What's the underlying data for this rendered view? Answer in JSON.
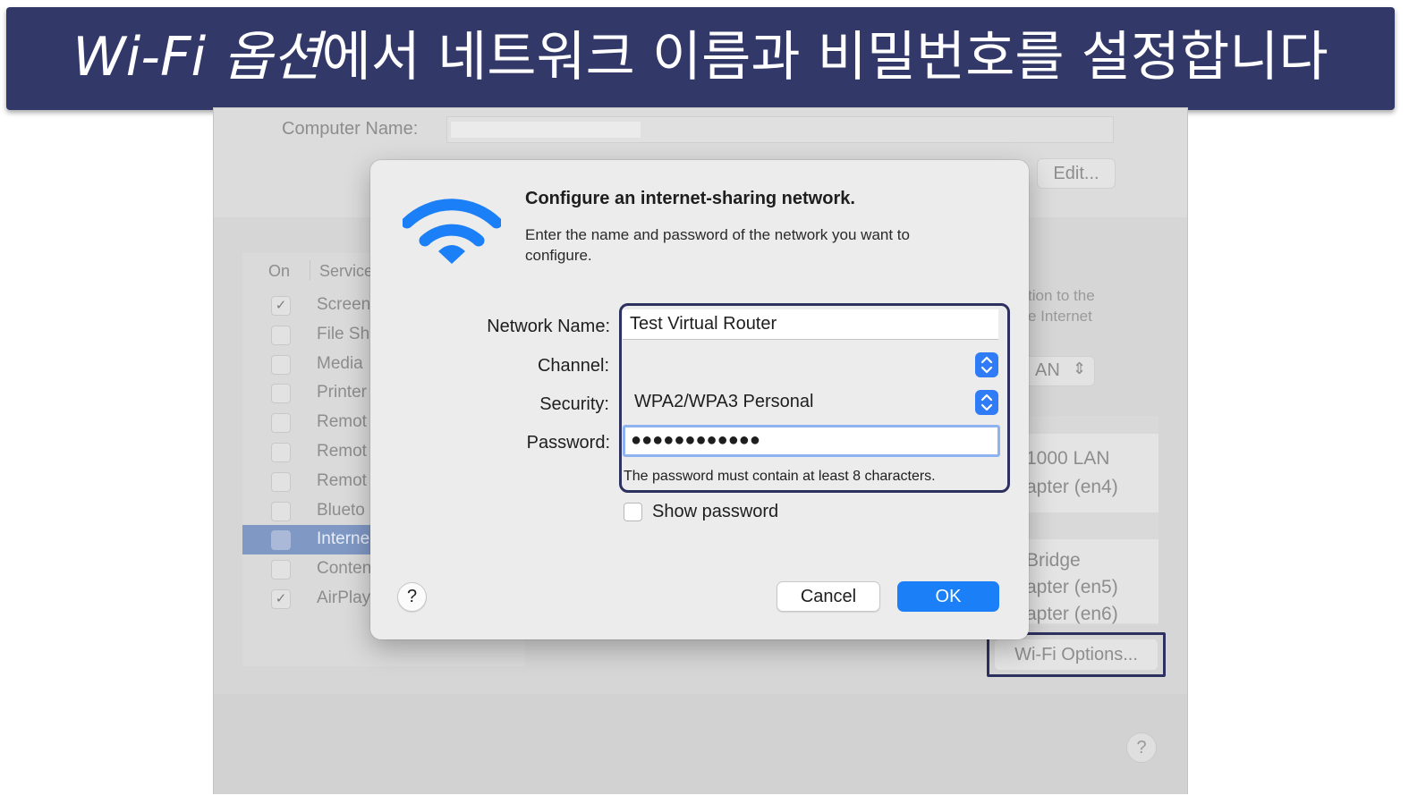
{
  "banner": {
    "title_em": "Wi-Fi 옵션",
    "title_rest": "에서 네트워크 이름과 비밀번호를 설정합니다"
  },
  "background": {
    "computer_name_label": "Computer Name:",
    "edit_button": "Edit...",
    "services_header": {
      "on": "On",
      "service": "Service"
    },
    "services": [
      {
        "label": "Screen",
        "checked": true,
        "selected": false
      },
      {
        "label": "File Sh",
        "checked": false,
        "selected": false
      },
      {
        "label": "Media",
        "checked": false,
        "selected": false
      },
      {
        "label": "Printer",
        "checked": false,
        "selected": false
      },
      {
        "label": "Remot",
        "checked": false,
        "selected": false
      },
      {
        "label": "Remot",
        "checked": false,
        "selected": false
      },
      {
        "label": "Remot",
        "checked": false,
        "selected": false
      },
      {
        "label": "Blueto",
        "checked": false,
        "selected": false
      },
      {
        "label": "Interne",
        "checked": false,
        "selected": true
      },
      {
        "label": "Conten",
        "checked": false,
        "selected": false
      },
      {
        "label": "AirPlay",
        "checked": true,
        "selected": false
      }
    ],
    "share_desc_line1": "tion to the",
    "share_desc_line2": "e Internet",
    "popup_value": "AN",
    "ports": {
      "group1": [
        "1000 LAN",
        "apter (en4)"
      ],
      "group2": [
        "Bridge",
        "apter (en5)",
        "apter (en6)"
      ]
    },
    "wifi_options_button": "Wi-Fi Options...",
    "help": "?"
  },
  "dialog": {
    "title": "Configure an internet-sharing network.",
    "description": "Enter the name and password of the network you want to configure.",
    "labels": {
      "network_name": "Network Name:",
      "channel": "Channel:",
      "security": "Security:",
      "password": "Password:"
    },
    "network_name_value": "Test Virtual Router",
    "channel_value": "",
    "security_value": "WPA2/WPA3 Personal",
    "password_value": "●●●●●●●●●●●●",
    "password_hint": "The password must contain at least 8 characters.",
    "show_password_label": "Show password",
    "show_password_checked": false,
    "help": "?",
    "cancel": "Cancel",
    "ok": "OK"
  },
  "colors": {
    "banner_bg": "#323868",
    "highlight_outline": "#2e3160",
    "accent_blue": "#1b7ff7",
    "wifi_icon": "#1b7ff7"
  },
  "icons": [
    "wifi-icon",
    "stepper-icon",
    "checkmark-icon",
    "chevron-updown-icon",
    "help-icon"
  ]
}
